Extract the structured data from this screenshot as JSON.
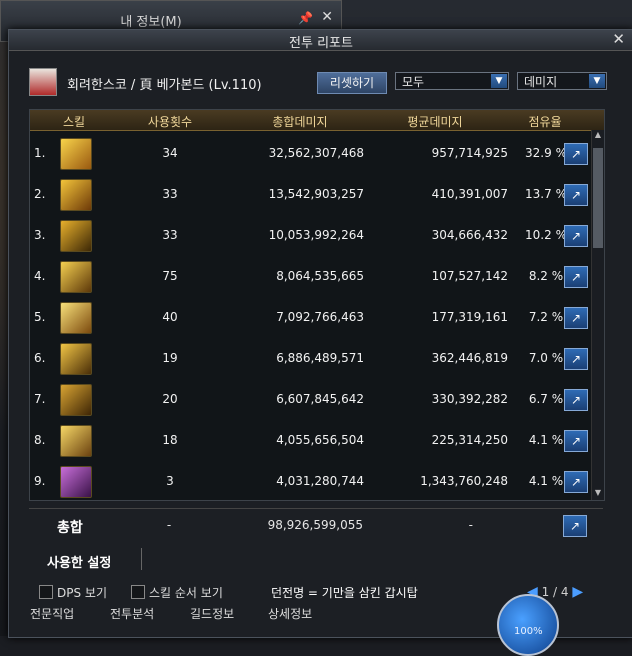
{
  "back_window": {
    "title": "내 정보(M)"
  },
  "window": {
    "title": "전투 리포트"
  },
  "character": {
    "name": "회려한스코 / 頁 베가본드 (Lv.110)"
  },
  "controls": {
    "reset_label": "리셋하기",
    "filter_value": "모두",
    "metric_value": "데미지"
  },
  "table": {
    "headers": [
      "스킬",
      "사용횟수",
      "총합데미지",
      "평균데미지",
      "점유율"
    ],
    "rows": [
      {
        "rank": "1.",
        "uses": "34",
        "total": "32,562,307,468",
        "avg": "957,714,925",
        "share": "32.9 %"
      },
      {
        "rank": "2.",
        "uses": "33",
        "total": "13,542,903,257",
        "avg": "410,391,007",
        "share": "13.7 %"
      },
      {
        "rank": "3.",
        "uses": "33",
        "total": "10,053,992,264",
        "avg": "304,666,432",
        "share": "10.2 %"
      },
      {
        "rank": "4.",
        "uses": "75",
        "total": "8,064,535,665",
        "avg": "107,527,142",
        "share": "8.2 %"
      },
      {
        "rank": "5.",
        "uses": "40",
        "total": "7,092,766,463",
        "avg": "177,319,161",
        "share": "7.2 %"
      },
      {
        "rank": "6.",
        "uses": "19",
        "total": "6,886,489,571",
        "avg": "362,446,819",
        "share": "7.0 %"
      },
      {
        "rank": "7.",
        "uses": "20",
        "total": "6,607,845,642",
        "avg": "330,392,282",
        "share": "6.7 %"
      },
      {
        "rank": "8.",
        "uses": "18",
        "total": "4,055,656,504",
        "avg": "225,314,250",
        "share": "4.1 %"
      },
      {
        "rank": "9.",
        "uses": "3",
        "total": "4,031,280,744",
        "avg": "1,343,760,248",
        "share": "4.1 %"
      }
    ]
  },
  "summary": {
    "label": "총합",
    "uses": "-",
    "total": "98,926,599,055",
    "avg": "-"
  },
  "used_settings": {
    "label": "사용한 설정"
  },
  "bottom": {
    "dps_label": "DPS 보기",
    "skill_order_label": "스킬 순서 보기",
    "info_text": "던전명 = 기만을 삼킨 갑시탑",
    "pager": "1 / 4"
  },
  "footer": {
    "tab1": "전문직업",
    "tab2": "전투분석",
    "tab3": "길드정보",
    "tab4": "상세정보",
    "orb_text": "100%"
  },
  "colors": {
    "accent": "#2f6bb5",
    "header_gold": "#f0d79a"
  }
}
